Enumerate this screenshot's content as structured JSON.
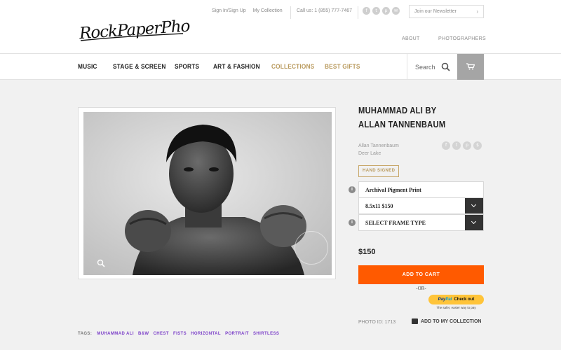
{
  "header": {
    "logo_text": "RockPaperPhoto",
    "sign_in": "Sign In/Sign Up",
    "my_collection": "My Collection",
    "phone": "Call us: 1 (855) 777-7467",
    "newsletter": "Join our Newsletter",
    "about": "ABOUT",
    "photographers": "PHOTOGRAPHERS"
  },
  "nav": {
    "items": [
      "MUSIC",
      "STAGE & SCREEN",
      "SPORTS",
      "ART & FASHION",
      "COLLECTIONS",
      "BEST GIFTS"
    ],
    "search_label": "Search"
  },
  "product": {
    "title": "MUHAMMAD ALI BY ALLAN TANNENBAUM",
    "artist": "Allan Tannenbaum",
    "location": "Deer Lake",
    "badge": "HAND SIGNED",
    "print_type": "Archival Pigment Print",
    "size_option": "8.5x11 $150",
    "frame_option": "SELECT FRAME TYPE",
    "price": "$150",
    "add_to_cart": "ADD TO CART",
    "or": "-OR-",
    "paypal_brand_1": "Pay",
    "paypal_brand_2": "Pal",
    "paypal_checkout": "Check out",
    "paypal_tagline": "The safer, easier way to pay",
    "photo_id": "PHOTO ID: 1713",
    "add_to_collection": "ADD TO MY COLLECTION"
  },
  "tags": {
    "label": "TAGS:",
    "items": [
      "MUHAMMAD ALI",
      "B&W",
      "CHEST",
      "FISTS",
      "HORIZONTAL",
      "PORTRAIT",
      "SHIRTLESS"
    ]
  },
  "colors": {
    "accent_orange": "#ff5a00",
    "gold": "#b99a5d",
    "tag_purple": "#7b3fc8",
    "paypal_yellow": "#ffc439"
  },
  "icons": [
    "facebook-icon",
    "twitter-icon",
    "pinterest-icon",
    "email-icon",
    "search-icon",
    "cart-icon",
    "zoom-icon",
    "info-icon",
    "chevron-down-icon",
    "collection-icon"
  ]
}
